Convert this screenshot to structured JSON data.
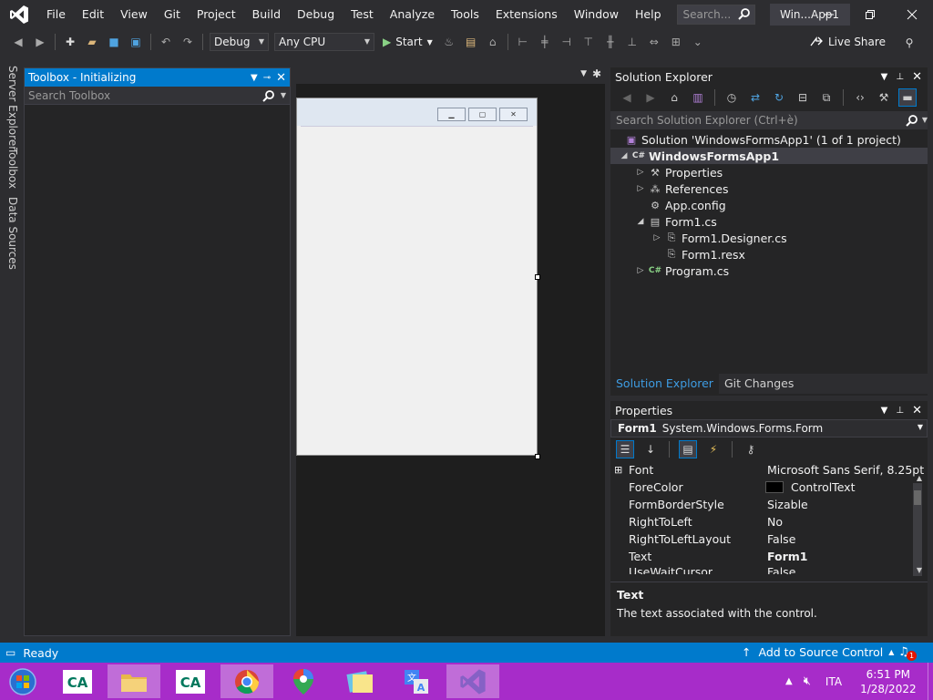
{
  "menubar": {
    "items": [
      "File",
      "Edit",
      "View",
      "Git",
      "Project",
      "Build",
      "Debug",
      "Test",
      "Analyze",
      "Tools",
      "Extensions",
      "Window",
      "Help"
    ],
    "search_placeholder": "Search...",
    "window_title": "Win...App1"
  },
  "toolbar": {
    "config": "Debug",
    "platform": "Any CPU",
    "start_label": "Start",
    "live_share": "Live Share"
  },
  "sidetabs": [
    "Server Explorer",
    "Toolbox",
    "Data Sources"
  ],
  "toolbox": {
    "title": "Toolbox - Initializing",
    "search_placeholder": "Search Toolbox"
  },
  "solution_explorer": {
    "title": "Solution Explorer",
    "search_placeholder": "Search Solution Explorer (Ctrl+è)",
    "tree": [
      {
        "label": "Solution 'WindowsFormsApp1' (1 of 1 project)",
        "icon": "solution-icon"
      },
      {
        "label": "WindowsFormsApp1",
        "icon": "csharp-project-icon"
      },
      {
        "label": "Properties",
        "icon": "wrench-icon"
      },
      {
        "label": "References",
        "icon": "references-icon"
      },
      {
        "label": "App.config",
        "icon": "config-file-icon"
      },
      {
        "label": "Form1.cs",
        "icon": "form-icon"
      },
      {
        "label": "Form1.Designer.cs",
        "icon": "code-file-icon"
      },
      {
        "label": "Form1.resx",
        "icon": "resx-file-icon"
      },
      {
        "label": "Program.cs",
        "icon": "csharp-file-icon"
      }
    ],
    "tabs": [
      "Solution Explorer",
      "Git Changes"
    ]
  },
  "properties": {
    "title": "Properties",
    "object_name": "Form1",
    "object_type": "System.Windows.Forms.Form",
    "rows": [
      {
        "name": "Font",
        "value": "Microsoft Sans Serif, 8.25pt"
      },
      {
        "name": "ForeColor",
        "value": "ControlText"
      },
      {
        "name": "FormBorderStyle",
        "value": "Sizable"
      },
      {
        "name": "RightToLeft",
        "value": "No"
      },
      {
        "name": "RightToLeftLayout",
        "value": "False"
      },
      {
        "name": "Text",
        "value": "Form1"
      },
      {
        "name": "UseWaitCursor",
        "value": "False"
      }
    ],
    "desc_title": "Text",
    "desc_text": "The text associated with the control."
  },
  "statusbar": {
    "status": "Ready",
    "source_control": "Add to Source Control",
    "notifications": "1"
  },
  "taskbar": {
    "language": "ITA",
    "time": "6:51 PM",
    "date": "1/28/2022"
  },
  "colors": {
    "accent": "#007acc",
    "taskbar": "#a72cc9",
    "vs_purple": "#8661c5"
  }
}
